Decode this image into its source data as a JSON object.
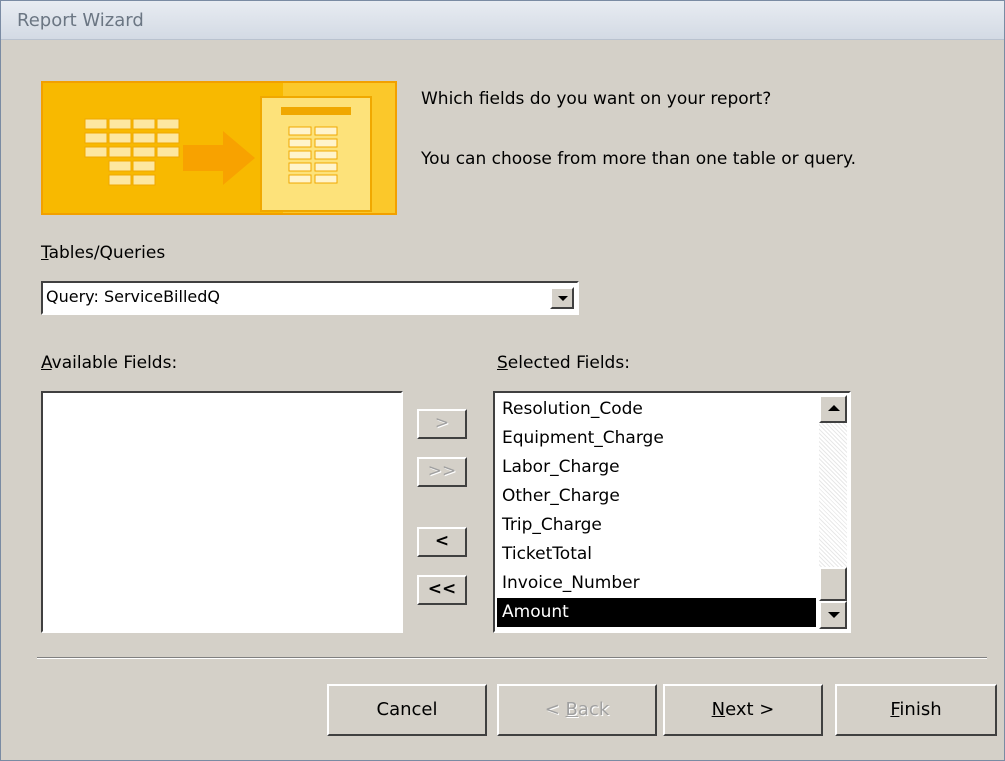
{
  "window": {
    "title": "Report Wizard"
  },
  "prompt": {
    "question": "Which fields do you want on your report?",
    "hint": "You can choose from more than one table or query."
  },
  "tables_queries": {
    "label_key": "T",
    "label_rest": "ables/Queries",
    "value": "Query: ServiceBilledQ"
  },
  "available_fields": {
    "label_key": "A",
    "label_rest": "vailable Fields:",
    "items": []
  },
  "selected_fields": {
    "label_key": "S",
    "label_rest": "elected Fields:",
    "items": [
      "Resolution_Code",
      "Equipment_Charge",
      "Labor_Charge",
      "Other_Charge",
      "Trip_Charge",
      "TicketTotal",
      "Invoice_Number",
      "Amount"
    ],
    "selected_item": "Amount"
  },
  "move_buttons": {
    "add": ">",
    "add_all": ">>",
    "remove": "<",
    "remove_all": "<<"
  },
  "buttons": {
    "cancel": "Cancel",
    "back_prefix": "< ",
    "back_key": "B",
    "back_rest": "ack",
    "next_key": "N",
    "next_rest": "ext >",
    "finish_key": "F",
    "finish_rest": "inish"
  },
  "colors": {
    "banner": "#f8b900",
    "dialog_bg": "#d4d0c8",
    "selection": "#000000"
  }
}
